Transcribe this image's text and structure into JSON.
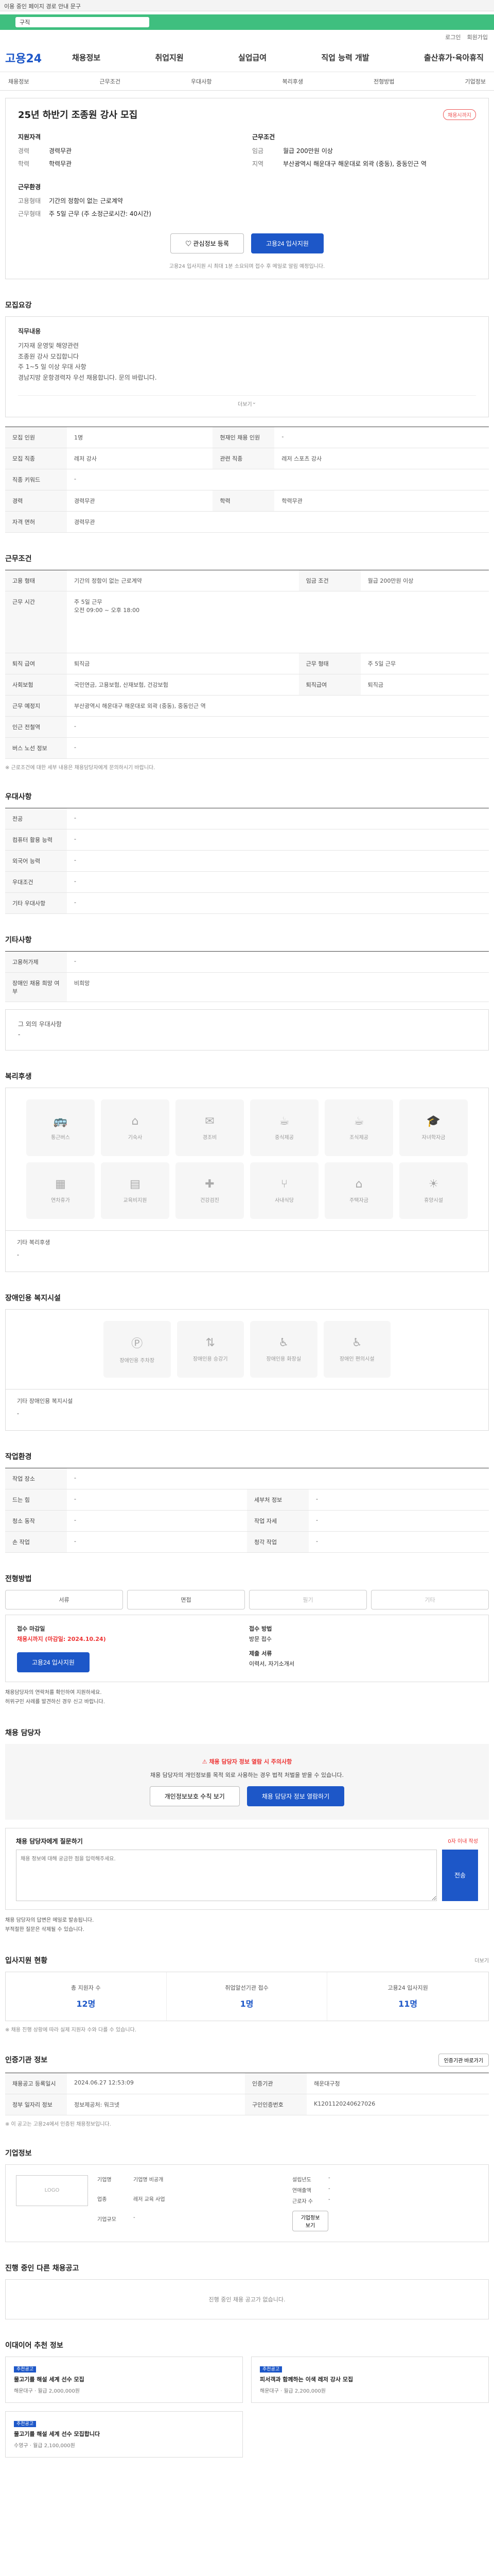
{
  "topbar": {
    "notice": "이용 중인 페이지 경로 안내 문구"
  },
  "greenbar": {
    "pill": "구직"
  },
  "util": [
    "로그인",
    "회원가입"
  ],
  "header": {
    "logo": "고용24",
    "menu": [
      "채용정보",
      "취업지원",
      "실업급여",
      "직업 능력 개발",
      "출산휴가·육아휴직"
    ]
  },
  "subnav": [
    "채용정보",
    "근무조건",
    "우대사항",
    "복리후생",
    "전형방법",
    "기업정보"
  ],
  "job": {
    "title": "25년 하반기 조종원 강사 모집",
    "badge": "채용시까지",
    "left_title": "지원자격",
    "left": [
      [
        "경력",
        "경력무관"
      ],
      [
        "학력",
        "학력무관"
      ]
    ],
    "left2_title": "근무환경",
    "left2": [
      [
        "고용형태",
        "기간의 정함이 없는 근로계약"
      ],
      [
        "근무형태",
        "주 5일 근무 (주 소정근로시간: 40시간)"
      ]
    ],
    "right_title": "근무조건",
    "right": [
      [
        "임금",
        "월급 200만원 이상"
      ],
      [
        "지역",
        "부산광역시 해운대구 해운대로 외곽 (중동), 중동인근 역"
      ]
    ],
    "btn_save": "관심정보 등록",
    "btn_apply": "고용24 입사지원",
    "note": "고용24 입사지원 시 최대 1분 소요되며 접수 후 메일로 알림 예정입니다."
  },
  "recruit": {
    "title": "모집요강",
    "duty_title": "직무내용",
    "duty_lines": [
      "기자재 운영및 해양관련",
      "조종원 강사 모집합니다",
      "주 1~5 일 이상 우대 사항",
      "경남지방 운항경력자 우선 채용합니다. 문의 바랍니다."
    ],
    "more": "더보기",
    "rows": [
      [
        "모집 인원",
        "1명",
        "현재인 채용 인원",
        "-"
      ],
      [
        "모집 직종",
        "레저 강사",
        "관련 직종",
        "레저 스포츠 강사"
      ],
      [
        "직종 키워드",
        "-",
        "",
        ""
      ],
      [
        "경력",
        "경력무관",
        "학력",
        "학력무관"
      ],
      [
        "자격 면허",
        "경력무관",
        "",
        ""
      ]
    ]
  },
  "work": {
    "title": "근무조건",
    "rows": [
      [
        "고용 형태",
        "기간의 정함이 없는 근로계약",
        "임금 조건",
        "월급 200만원 이상"
      ],
      [
        "근무 시간",
        "주 소정근로시간: 40시간",
        "",
        ""
      ],
      [
        "퇴직 급여",
        "퇴직금",
        "근무 형태",
        "주 5일 근무"
      ],
      [
        "사회보험",
        "국민연금, 고용보험, 산재보험, 건강보험",
        "퇴직급여",
        "퇴직금"
      ],
      [
        "근무 예정지",
        "부산광역시 해운대구 해운대로 외곽 (중동), 중동인근 역",
        "",
        ""
      ],
      [
        "인근 전철역",
        "-",
        "",
        ""
      ],
      [
        "버스 노선 정보",
        "-",
        "",
        ""
      ]
    ],
    "hours": "주 5일 근무\n오전 09:00 ~ 오후 18:00",
    "note": "※ 근로조건에 대한 세부 내용은 채용담당자에게 문의하시기 바랍니다."
  },
  "pref": {
    "title": "우대사항",
    "rows": [
      [
        "전공",
        "-"
      ],
      [
        "컴퓨터 활용 능력",
        "-"
      ],
      [
        "외국어 능력",
        "-"
      ],
      [
        "우대조건",
        "-"
      ],
      [
        "기타 우대사항",
        "-"
      ]
    ]
  },
  "etc": {
    "title": "기타사항",
    "rows": [
      [
        "고용허가제",
        "-"
      ],
      [
        "장애인 채용 희망 여부",
        "비희망"
      ]
    ],
    "extra_label": "그 외의 우대사항",
    "extra": "-"
  },
  "welfare": {
    "title": "복리후생",
    "items": [
      "통근버스",
      "기숙사",
      "경조비",
      "중식제공",
      "조식제공",
      "자녀학자금",
      "연차휴가",
      "교육비지원",
      "건강검진",
      "사내식당",
      "주택자금",
      "휴양시설"
    ],
    "sub_label": "기타 복리후생",
    "sub_val": "-"
  },
  "support": {
    "title": "장애인용 복지시설",
    "items": [
      "장애인용 주차장",
      "장애인용 승강기",
      "장애인용 화장실",
      "장애인 편의시설"
    ],
    "sub_label": "기타 장애인용 복지시설",
    "sub_val": "-"
  },
  "env": {
    "title": "작업환경",
    "rows": [
      [
        "작업 장소",
        "-",
        "",
        ""
      ],
      [
        "드는 힘",
        "-",
        "세부처 정보",
        "-"
      ],
      [
        "청소 동작",
        "-",
        "작업 자세",
        "-"
      ],
      [
        "손 작업",
        "-",
        "청각 작업",
        "-"
      ]
    ]
  },
  "select": {
    "title": "전형방법",
    "tabs": [
      "서류",
      "면접",
      "필기",
      "기타"
    ],
    "period_label": "접수 마감일",
    "period": "채용시까지 (마감일: 2024.10.24)",
    "method_label": "접수 방법",
    "method": "방문 접수",
    "doc_label": "제출 서류",
    "doc": "이력서, 자기소개서",
    "btn": "고용24 입사지원",
    "bullets": [
      "채용담당자의 연락처를 확인하여 지원하세요.",
      "허위구인 사례를 발견하신 경우 신고 바랍니다."
    ]
  },
  "contact": {
    "title": "채용 담당자",
    "warn": "채용 담당자 정보 열람 시 주의사항",
    "warn_text": "채용 담당자의 개인정보를 목적 외로 사용하는 경우 법적 처벌을 받을 수 있습니다.",
    "btn1": "개인정보보호 수칙 보기",
    "btn2": "채용 담당자 정보 열람하기",
    "inq_title": "채용 담당자에게 질문하기",
    "inq_hint": "0자 이내 작성",
    "inq_placeholder": "채용 정보에 대해 궁금한 점을 입력해주세요.",
    "inq_btn": "전송",
    "bullets": [
      "채용 담당자의 답변은 메일로 발송됩니다.",
      "부적절한 질문은 삭제될 수 있습니다."
    ]
  },
  "stats": {
    "title": "입사지원 현황",
    "more": "더보기",
    "items": [
      [
        "총 지원자 수",
        "12명"
      ],
      [
        "취업알선기관 접수",
        "1명"
      ],
      [
        "고용24 입사지원",
        "11명"
      ]
    ],
    "note": "※ 채용 진행 상황에 따라 실제 지원자 수와 다를 수 있습니다."
  },
  "info": {
    "title": "인증기관 정보",
    "btn": "인증기관 바로가기",
    "rows": [
      [
        "채용공고 등록일시",
        "2024.06.27 12:53:09",
        "인증기관",
        "해운대구청"
      ],
      [
        "정부 일자리 정보",
        "정보제공처: 워크넷",
        "구인인증번호",
        "K1201120240627026"
      ]
    ],
    "note": "※ 이 공고는 고용24에서 인증된 채용정보입니다."
  },
  "company": {
    "title": "기업정보",
    "btn": "기업정보 보기",
    "logo": "LOGO",
    "rows1": [
      [
        "기업명",
        "기업명 비공개"
      ],
      [
        "업종",
        "레저 교육 사업"
      ],
      [
        "기업규모",
        "-"
      ]
    ],
    "rows2": [
      [
        "설립년도",
        "-"
      ],
      [
        "연매출액",
        "-"
      ],
      [
        "근로자 수",
        "-"
      ]
    ]
  },
  "other": {
    "title": "진행 중인 다른 채용공고",
    "empty": "진행 중인 채용 공고가 없습니다."
  },
  "recommend": {
    "title": "이대이어 추천 정보",
    "items": [
      {
        "tag": "추천공고",
        "title": "물고기를 해설 세계 선수 모집",
        "meta": "해운대구 · 월급 2,000,000원"
      },
      {
        "tag": "추천공고",
        "title": "피서객과 함께하는 이색 레저 강사 모집",
        "meta": "해운대구 · 월급 2,200,000원"
      },
      {
        "tag": "추천공고",
        "title": "물고기를 해설 세계 선수 모집합니다",
        "meta": "수영구 · 월급 2,100,000원"
      }
    ]
  }
}
